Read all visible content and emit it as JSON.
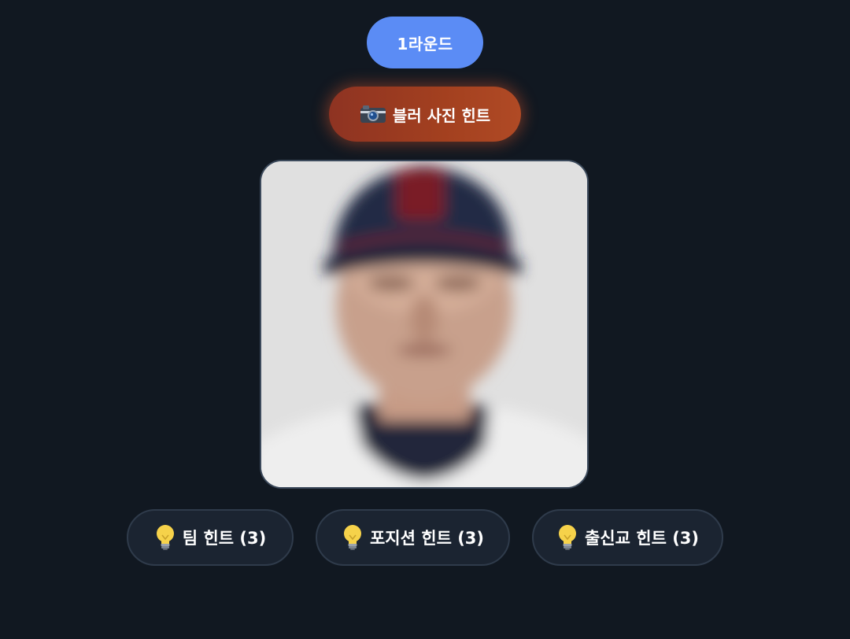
{
  "round": {
    "label": "1라운드",
    "color": "#5b8cf5"
  },
  "blur_hint": {
    "icon": "camera-icon",
    "label": "블러 사진 힌트",
    "color": "#a3401f"
  },
  "photo": {
    "description_icon": "player-photo"
  },
  "hints": [
    {
      "icon": "lightbulb-icon",
      "label": "팀 힌트 (3)"
    },
    {
      "icon": "lightbulb-icon",
      "label": "포지션 힌트 (3)"
    },
    {
      "icon": "lightbulb-icon",
      "label": "출신교 힌트 (3)"
    }
  ],
  "colors": {
    "background": "#111821",
    "hint_button_bg": "#1b2431"
  }
}
